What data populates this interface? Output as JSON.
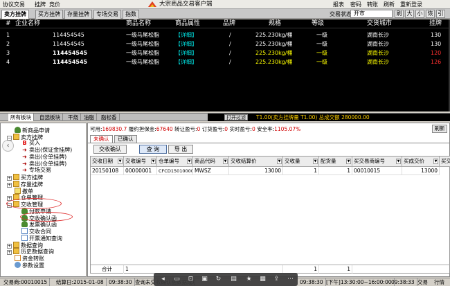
{
  "menubar": {
    "left": [
      "协议交易",
      "挂牌",
      "竞价"
    ],
    "title": "大宗商品交易客户端",
    "right": [
      "报表",
      "密码",
      "转账",
      "刷新",
      "重新登录"
    ]
  },
  "tabbar": {
    "tabs": [
      "卖方挂牌",
      "买方挂牌",
      "存量挂牌",
      "专场交易",
      "指数"
    ],
    "active_index": 0,
    "status_label": "交易状态:",
    "status_value": "开市",
    "tool_buttons": [
      "刷",
      "大",
      "小",
      "恢",
      "引"
    ]
  },
  "market": {
    "headers": [
      "#",
      "企业名称",
      "商品名称",
      "商品属性",
      "品牌",
      "规格",
      "等级",
      "交货城市",
      "挂牌"
    ],
    "rows": [
      {
        "idx": "1",
        "id": "114454545",
        "name": "一级马尾松脂",
        "attr": "【详细】",
        "brand": "/",
        "spec": "225.230kg/桶",
        "grade": "一级",
        "city": "湖南长沙",
        "last": "130"
      },
      {
        "idx": "2",
        "id": "114454545",
        "name": "一级马尾松脂",
        "attr": "【详细】",
        "brand": "/",
        "spec": "225.230kg/桶",
        "grade": "一级",
        "city": "湖南长沙",
        "last": "130"
      },
      {
        "idx": "3",
        "id": "114454545",
        "name": "一级马尾松脂",
        "attr": "【详细】",
        "brand": "/",
        "spec": "225.230kg/桶",
        "grade": "一级",
        "city": "湖南长沙",
        "last": "120"
      },
      {
        "idx": "4",
        "id": "114454545",
        "name": "一级马尾松脂",
        "attr": "【详细】",
        "brand": "/",
        "spec": "225.230kg/桶",
        "grade": "一级",
        "city": "湖南长沙",
        "last": "126"
      }
    ]
  },
  "midbar": {
    "tabs": [
      "所有板块",
      "自选板块",
      "干烧",
      "油脂",
      "脂松香"
    ],
    "ticker_button": "打开过滤",
    "ticker_text": "T1.00(卖方挂牌量 T1.00)    总成交额 280000.00"
  },
  "sidebar": {
    "items": [
      {
        "label": "新商品申请",
        "icon": "person-icon"
      },
      {
        "label": "卖方挂牌",
        "icon": "folder-icon"
      },
      {
        "label": "买入",
        "icon": "buy-icon"
      },
      {
        "label": "卖出(保证金挂牌)",
        "icon": "sell-icon"
      },
      {
        "label": "卖出(仓单挂牌)",
        "icon": "sell-icon"
      },
      {
        "label": "卖出(仓单挂牌)",
        "icon": "sell-icon"
      },
      {
        "label": "专场交易",
        "icon": "sell-icon"
      },
      {
        "label": "买方挂牌",
        "icon": "folder-icon"
      },
      {
        "label": "存量挂牌",
        "icon": "folder-icon"
      },
      {
        "label": "撤单",
        "icon": "cancel-icon"
      },
      {
        "label": "仓单管理",
        "icon": "folder-icon"
      },
      {
        "label": "交收管理",
        "icon": "folder-icon"
      },
      {
        "label": "付款申请",
        "icon": "person-icon"
      },
      {
        "label": "交收确认函",
        "icon": "person-icon"
      },
      {
        "label": "发票确认函",
        "icon": "person-icon"
      },
      {
        "label": "交收合同",
        "icon": "doc-icon"
      },
      {
        "label": "开票通知查询",
        "icon": "doc-icon"
      },
      {
        "label": "数据查询",
        "icon": "folder-icon"
      },
      {
        "label": "历史数据查询",
        "icon": "folder-icon"
      },
      {
        "label": "资金转账",
        "icon": "transfer-icon"
      },
      {
        "label": "参数设置",
        "icon": "gear-icon"
      }
    ]
  },
  "main": {
    "account": {
      "available_label": "可用:",
      "available": "169830.7",
      "margin_label": "履约担保金:",
      "margin": "67640",
      "transfer_label": "转让盈亏:",
      "transfer": "0",
      "order_label": "订货盈亏:",
      "order": "0",
      "realtime_label": "实时盈亏:",
      "realtime": "0",
      "safety_label": "安全率:",
      "safety": "1105.07%"
    },
    "refresh_label": "刷新",
    "subtabs": [
      "未确认",
      "已确认"
    ],
    "buttons": {
      "confirm": "交收确认",
      "query": "查 询",
      "export": "导 出"
    },
    "grid": {
      "headers": [
        "交收日期",
        "交收编号",
        "仓单编号",
        "商品代码",
        "交收结算价",
        "交收量",
        "配货量",
        "买交易商编号",
        "买成交价",
        "买交"
      ],
      "rows": [
        [
          "20150108",
          "00000001",
          "CFCD15010000",
          "MWSZ",
          "13000",
          "1",
          "1",
          "00010015",
          "13000",
          ""
        ]
      ],
      "sum": {
        "label": "合计",
        "count": "1",
        "qty1": "1",
        "qty2": "1"
      }
    }
  },
  "statusbar": {
    "trader": "交易商:00010015",
    "settle": "结算日:2015-01-08",
    "time1": "09:38:30",
    "message": "查询未交收确认函数据成功",
    "time2": "09:38:30",
    "session": "[下午]13:30:00~16:00:00",
    "time3": "09:38:33",
    "right1": "交易",
    "right2": "行情"
  }
}
